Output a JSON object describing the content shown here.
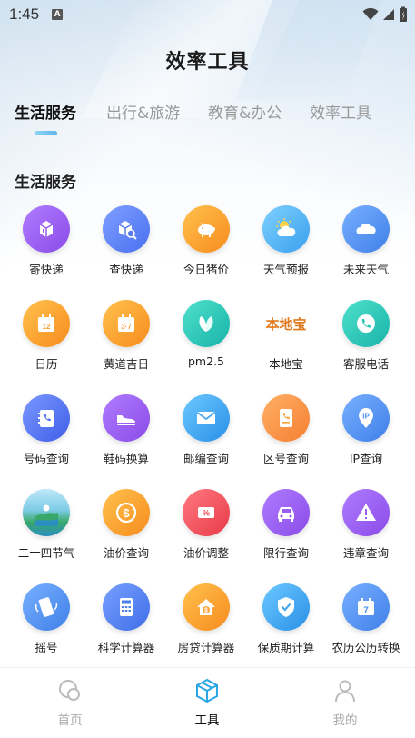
{
  "status_bar": {
    "time": "1:45",
    "notification_icon": "A"
  },
  "page_title": "效率工具",
  "tabs": [
    {
      "label": "生活服务",
      "active": true
    },
    {
      "label": "出行&旅游",
      "active": false
    },
    {
      "label": "教育&办公",
      "active": false
    },
    {
      "label": "效率工具",
      "active": false
    }
  ],
  "section_title": "生活服务",
  "tools": [
    {
      "label": "寄快递",
      "icon": "package-send-icon",
      "color": "#9b5cf0"
    },
    {
      "label": "查快递",
      "icon": "package-search-icon",
      "color": "#5c7cf0"
    },
    {
      "label": "今日猪价",
      "icon": "pig-icon",
      "color": "#f9a33a"
    },
    {
      "label": "天气预报",
      "icon": "sun-cloud-icon",
      "color": "#48b4f0"
    },
    {
      "label": "未来天气",
      "icon": "cloud-icon",
      "color": "#4a8ff0"
    },
    {
      "label": "日历",
      "icon": "calendar-12-icon",
      "color": "#f9a33a"
    },
    {
      "label": "黄道吉日",
      "icon": "calendar-37-icon",
      "color": "#f9a33a"
    },
    {
      "label": "pm2.5",
      "icon": "leaf-icon",
      "color": "#26c4b5"
    },
    {
      "label": "本地宝",
      "icon": "bendibao-logo",
      "logo_text": "本地宝",
      "color": "#e07a1f"
    },
    {
      "label": "客服电话",
      "icon": "phone-icon",
      "color": "#26c4b5"
    },
    {
      "label": "号码查询",
      "icon": "phonebook-icon",
      "color": "#4a6ff0"
    },
    {
      "label": "鞋码换算",
      "icon": "shoe-icon",
      "color": "#9b5cf0"
    },
    {
      "label": "邮编查询",
      "icon": "envelope-icon",
      "color": "#48a8f0"
    },
    {
      "label": "区号查询",
      "icon": "phone-doc-icon",
      "color": "#f9a33a"
    },
    {
      "label": "IP查询",
      "icon": "ip-pin-icon",
      "color": "#4a8ff0"
    },
    {
      "label": "二十四节气",
      "icon": "landscape-icon",
      "color": "#3fb0d8"
    },
    {
      "label": "油价查询",
      "icon": "dollar-coin-icon",
      "color": "#f9a33a"
    },
    {
      "label": "油价调整",
      "icon": "percent-ticket-icon",
      "color": "#f04a55"
    },
    {
      "label": "限行查询",
      "icon": "car-icon",
      "color": "#9b5cf0"
    },
    {
      "label": "违章查询",
      "icon": "warning-icon",
      "color": "#9b5cf0"
    },
    {
      "label": "摇号",
      "icon": "shake-phone-icon",
      "color": "#4a8ff0"
    },
    {
      "label": "科学计算器",
      "icon": "calculator-icon",
      "color": "#4a7ff0"
    },
    {
      "label": "房贷计算器",
      "icon": "house-dollar-icon",
      "color": "#f9a33a"
    },
    {
      "label": "保质期计算",
      "icon": "shield-check-icon",
      "color": "#48a8f0"
    },
    {
      "label": "农历公历转换",
      "icon": "calendar-7-icon",
      "color": "#4a8ff0"
    }
  ],
  "bottom_nav": [
    {
      "label": "首页",
      "icon": "home-circles-icon",
      "active": false
    },
    {
      "label": "工具",
      "icon": "toolbox-cube-icon",
      "active": true
    },
    {
      "label": "我的",
      "icon": "person-icon",
      "active": false
    }
  ],
  "colors": {
    "accent": "#2aa6e6",
    "inactive": "#aaaaaa"
  }
}
